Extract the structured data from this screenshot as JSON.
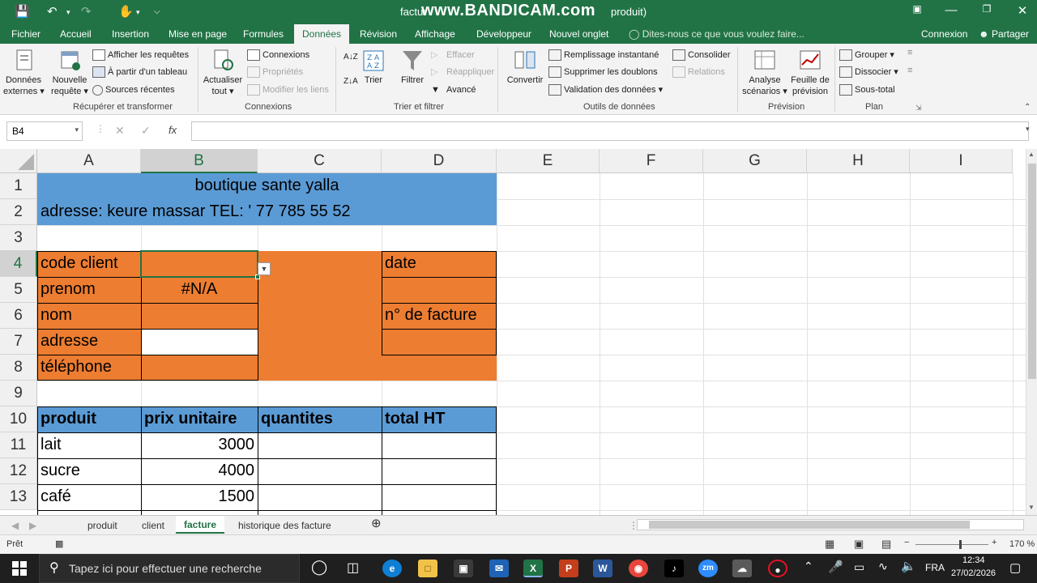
{
  "titlebar": {
    "title_left": "factur",
    "title_right": "produit)",
    "watermark": "www.BANDICAM.com"
  },
  "tabs": [
    "Fichier",
    "Accueil",
    "Insertion",
    "Mise en page",
    "Formules",
    "Données",
    "Révision",
    "Affichage",
    "Développeur",
    "Nouvel onglet"
  ],
  "tell_me": "Dites-nous ce que vous voulez faire...",
  "account": {
    "connexion": "Connexion",
    "share": "Partager"
  },
  "ribbon": {
    "donnees_externes": [
      "Données",
      "externes"
    ],
    "nouvelle_requete": [
      "Nouvelle",
      "requête"
    ],
    "afficher_requetes": "Afficher les requêtes",
    "partir_tableau": "À partir d'un tableau",
    "sources_recentes": "Sources récentes",
    "group_recuperer": "Récupérer et transformer",
    "actualiser": [
      "Actualiser",
      "tout"
    ],
    "connexions": "Connexions",
    "proprietes": "Propriétés",
    "modifier_liens": "Modifier les liens",
    "group_connexions": "Connexions",
    "trier": "Trier",
    "filtrer": "Filtrer",
    "effacer": "Effacer",
    "reappliquer": "Réappliquer",
    "avance": "Avancé",
    "group_trier": "Trier et filtrer",
    "convertir": "Convertir",
    "remplissage": "Remplissage instantané",
    "supprimer_doublons": "Supprimer les doublons",
    "validation": "Validation des données",
    "consolider": "Consolider",
    "relations": "Relations",
    "group_outils": "Outils de données",
    "analyse": [
      "Analyse",
      "scénarios"
    ],
    "feuille_prevision": [
      "Feuille de",
      "prévision"
    ],
    "group_prevision": "Prévision",
    "grouper": "Grouper",
    "dissocier": "Dissocier",
    "sous_total": "Sous-total",
    "group_plan": "Plan"
  },
  "formula_bar": {
    "name_box": "B4",
    "fx": "fx",
    "value": ""
  },
  "columns": [
    "A",
    "B",
    "C",
    "D",
    "E",
    "F",
    "G",
    "H",
    "I"
  ],
  "rows": [
    "1",
    "2",
    "3",
    "4",
    "5",
    "6",
    "7",
    "8",
    "9",
    "10",
    "11",
    "12",
    "13"
  ],
  "cells": {
    "title": "boutique sante yalla",
    "address": "adresse: keure massar TEL: ' 77 785 55 52",
    "code_client": "code client",
    "prenom": "prenom",
    "prenom_value": "#N/A",
    "nom": "nom",
    "adresse": "adresse",
    "telephone": "téléphone",
    "date": "date",
    "n_facture": "n° de facture",
    "h_produit": "produit",
    "h_prix": "prix unitaire",
    "h_quantites": "quantites",
    "h_total": "total HT",
    "p1": "lait",
    "v1": "3000",
    "p2": "sucre",
    "v2": "4000",
    "p3": "café",
    "v3": "1500"
  },
  "sheets": [
    "produit",
    "client",
    "facture",
    "historique des facture"
  ],
  "active_sheet": "facture",
  "status": {
    "ready": "Prêt",
    "zoom": "170 %"
  },
  "taskbar": {
    "search": "Tapez ici pour effectuer une recherche",
    "lang": "FRA",
    "time": "12:34",
    "date": "27/02/2026"
  },
  "colors": {
    "excel_green": "#217346",
    "header_blue": "#5b9bd5",
    "field_orange": "#ed7d31"
  }
}
